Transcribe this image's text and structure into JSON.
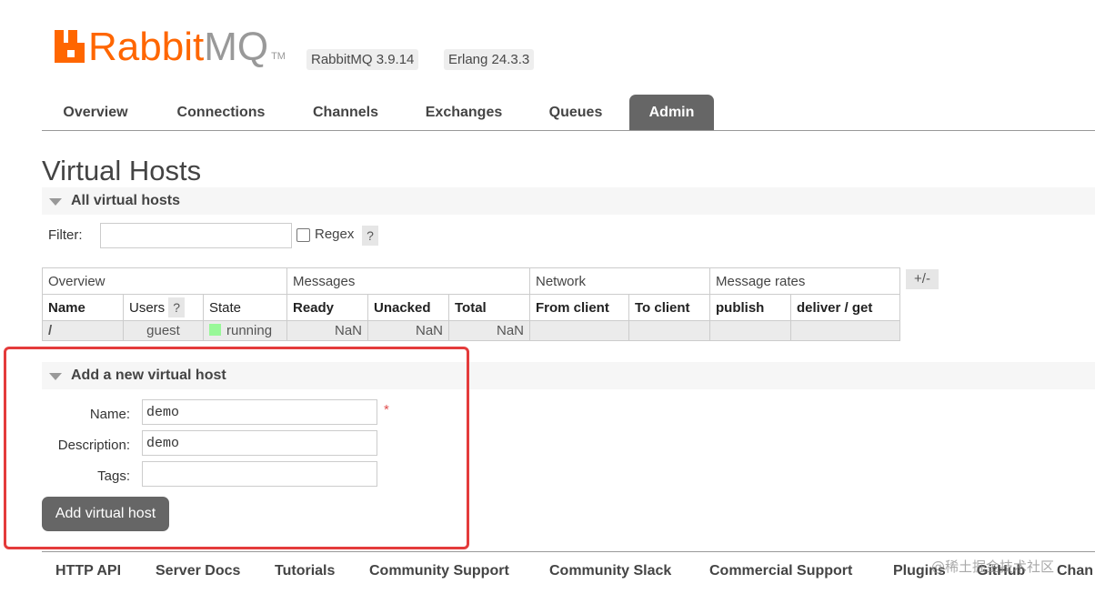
{
  "header": {
    "logo_primary": "Rabbit",
    "logo_secondary": "MQ",
    "logo_tm": "TM",
    "rabbitmq_version": "RabbitMQ 3.9.14",
    "erlang_version": "Erlang 24.3.3"
  },
  "tabs": [
    {
      "label": "Overview",
      "active": false
    },
    {
      "label": "Connections",
      "active": false
    },
    {
      "label": "Channels",
      "active": false
    },
    {
      "label": "Exchanges",
      "active": false
    },
    {
      "label": "Queues",
      "active": false
    },
    {
      "label": "Admin",
      "active": true
    }
  ],
  "page_title": "Virtual Hosts",
  "all_vhosts": {
    "section_title": "All virtual hosts",
    "filter_label": "Filter:",
    "filter_value": "",
    "regex_label": "Regex",
    "regex_checked": false,
    "help_glyph": "?",
    "plus_minus": "+/-",
    "table": {
      "groups": [
        "Overview",
        "Messages",
        "Network",
        "Message rates"
      ],
      "columns": [
        "Name",
        "Users",
        "State",
        "Ready",
        "Unacked",
        "Total",
        "From client",
        "To client",
        "publish",
        "deliver / get"
      ],
      "rows": [
        {
          "name": "/",
          "users": "guest",
          "state": "running",
          "ready": "NaN",
          "unacked": "NaN",
          "total": "NaN",
          "from_client": "",
          "to_client": "",
          "publish": "",
          "deliver_get": ""
        }
      ]
    }
  },
  "add_vhost": {
    "section_title": "Add a new virtual host",
    "name_label": "Name:",
    "name_value": "demo",
    "required_mark": "*",
    "description_label": "Description:",
    "description_value": "demo",
    "tags_label": "Tags:",
    "tags_value": "",
    "submit_label": "Add virtual host"
  },
  "highlight_color": "#e43b3b",
  "accent_color": "#ff6600",
  "footer": {
    "links": [
      "HTTP API",
      "Server Docs",
      "Tutorials",
      "Community Support",
      "Community Slack",
      "Commercial Support",
      "Plugins",
      "GitHub",
      "Chan"
    ]
  },
  "watermark": "@稀土掘金技术社区"
}
